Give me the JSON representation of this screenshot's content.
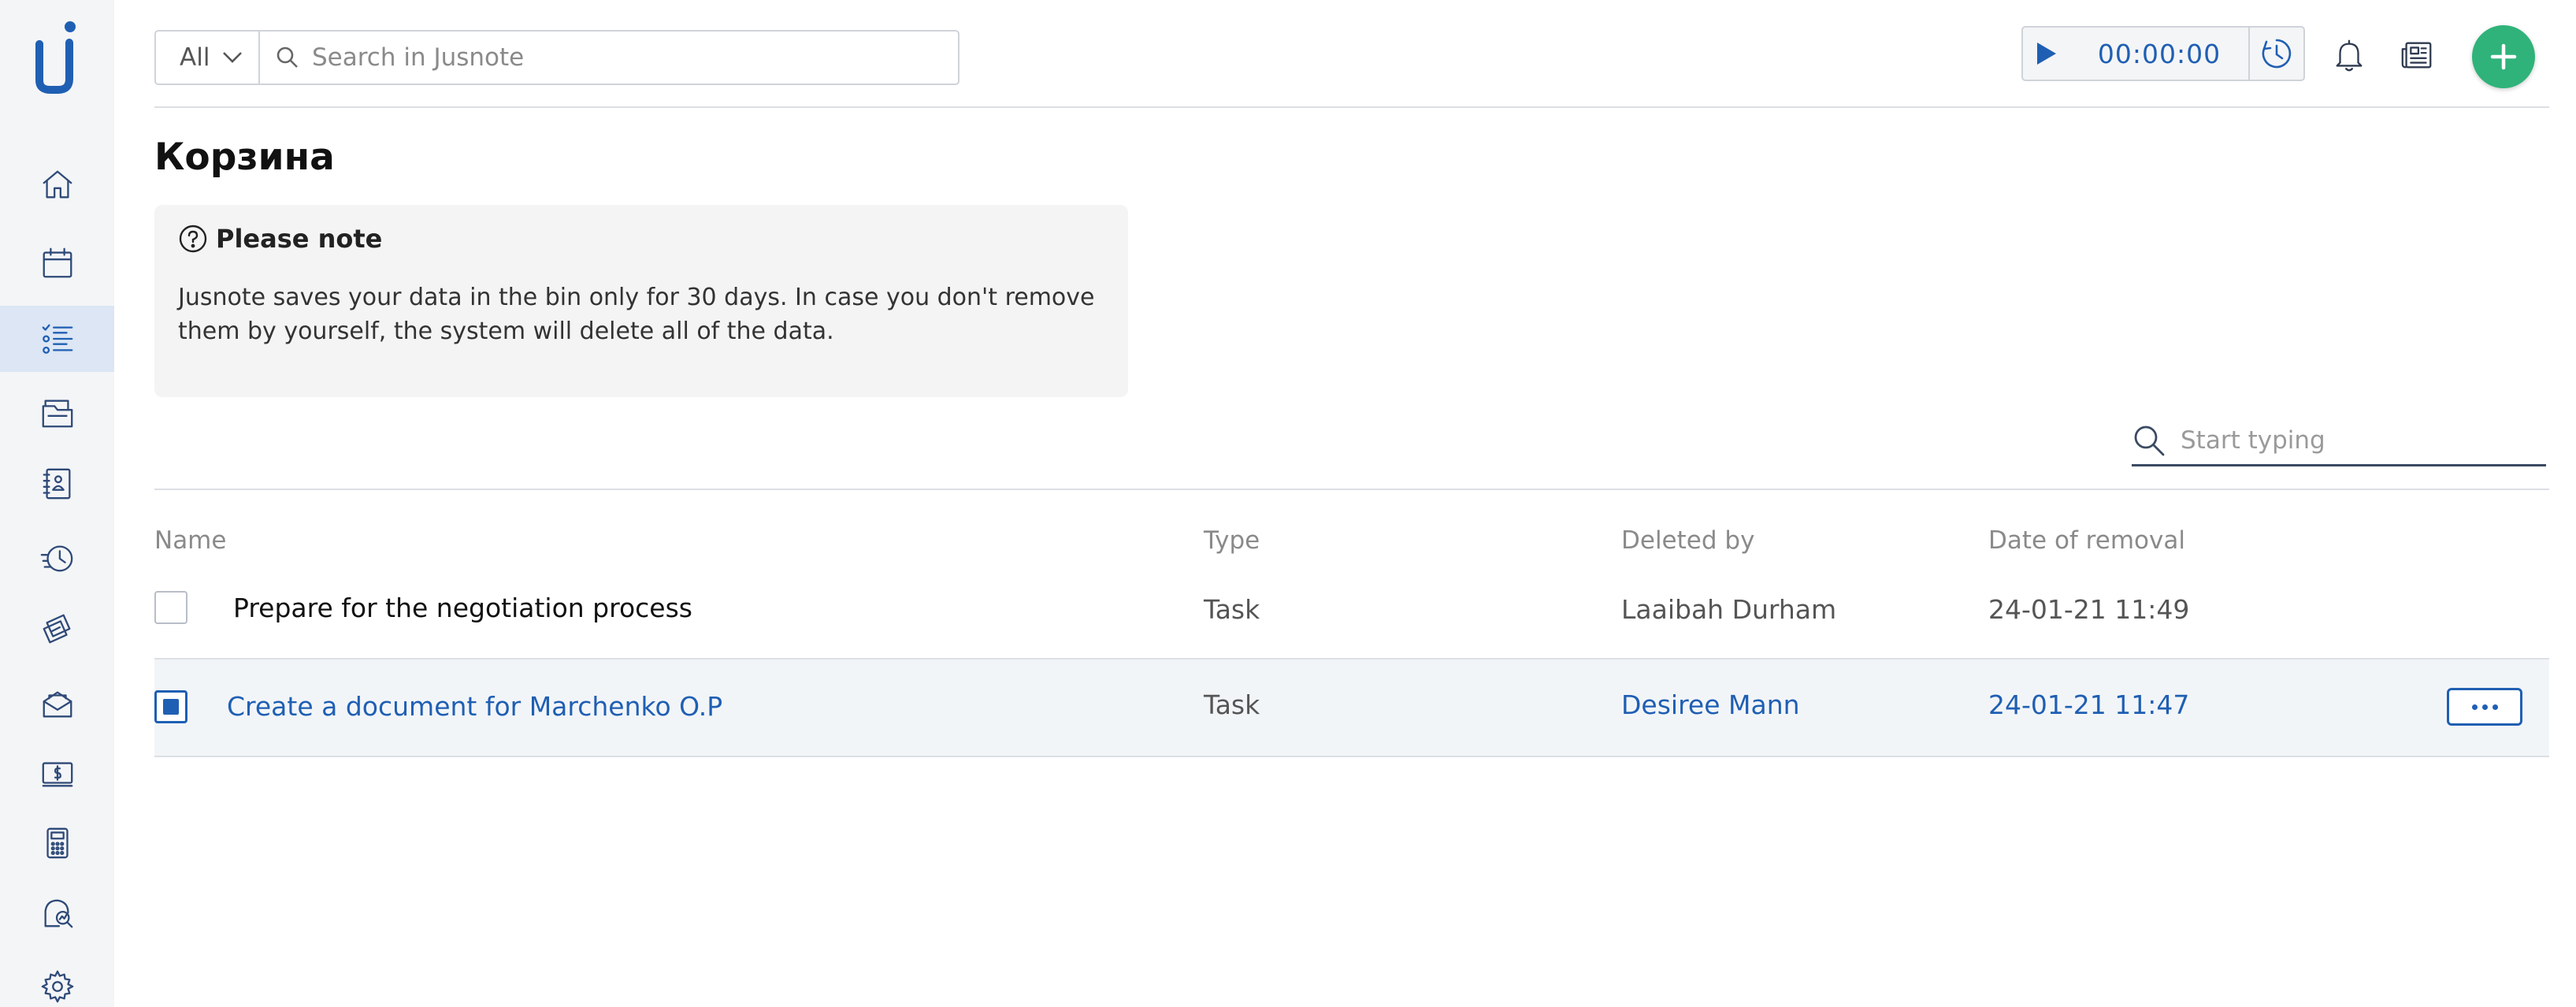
{
  "app": {
    "name": "Jusnote",
    "logo_letter": "j"
  },
  "sidebar": {
    "items": [
      {
        "id": "home",
        "icon": "home-icon"
      },
      {
        "id": "calendar",
        "icon": "calendar-icon"
      },
      {
        "id": "tasks",
        "icon": "task-list-icon",
        "active": true
      },
      {
        "id": "matters",
        "icon": "folders-icon"
      },
      {
        "id": "contacts",
        "icon": "contacts-book-icon"
      },
      {
        "id": "time",
        "icon": "time-history-icon"
      },
      {
        "id": "billing",
        "icon": "tickets-icon"
      },
      {
        "id": "accounts",
        "icon": "envelope-icon"
      },
      {
        "id": "finance",
        "icon": "money-icon"
      },
      {
        "id": "reports",
        "icon": "calculator-icon"
      },
      {
        "id": "analytics",
        "icon": "analytics-icon"
      },
      {
        "id": "settings",
        "icon": "gear-icon"
      }
    ]
  },
  "header": {
    "filter_value": "All",
    "search_placeholder": "Search in Jusnote",
    "timer_value": "00:00:00",
    "accent_color": "#1f5fb3",
    "add_color": "#2fb37a"
  },
  "page": {
    "title": "Корзина",
    "note_title": "Please note",
    "note_text": "Jusnote saves your data in the bin only for 30 days. In case you don't remove them by yourself, the system will delete all of the data."
  },
  "table": {
    "search_placeholder": "Start typing",
    "columns": [
      "Name",
      "Type",
      "Deleted by",
      "Date of removal"
    ],
    "rows": [
      {
        "name": "Prepare for the negotiation process",
        "type": "Task",
        "deleted_by": "Laaibah Durham",
        "date": "24-01-21 11:49",
        "checked": false
      },
      {
        "name": "Create a document for Marchenko O.P",
        "type": "Task",
        "deleted_by": "Desiree Mann",
        "date": "24-01-21 11:47",
        "checked": true
      }
    ]
  }
}
